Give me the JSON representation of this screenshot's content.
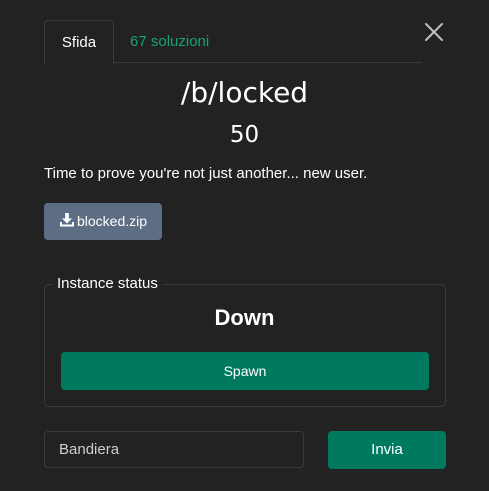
{
  "tabs": [
    {
      "label": "Sfida",
      "active": true
    },
    {
      "label": "67 soluzioni",
      "active": false
    }
  ],
  "challenge": {
    "name": "/b/locked",
    "points": "50",
    "description": "Time to prove you're not just another... new user."
  },
  "files": [
    {
      "label": "blocked.zip",
      "icon": "download-icon"
    }
  ],
  "instance": {
    "legend": "Instance status",
    "state": "Down",
    "spawn_label": "Spawn"
  },
  "submit": {
    "placeholder": "Bandiera",
    "value": "",
    "button_label": "Invia"
  },
  "icons": {
    "close": "close-icon",
    "download": "download-icon"
  },
  "colors": {
    "background": "#222222",
    "accent": "#007a5e",
    "solves_link": "#15a37a",
    "file_button": "#5d6d83",
    "border": "#3c3c3c"
  }
}
